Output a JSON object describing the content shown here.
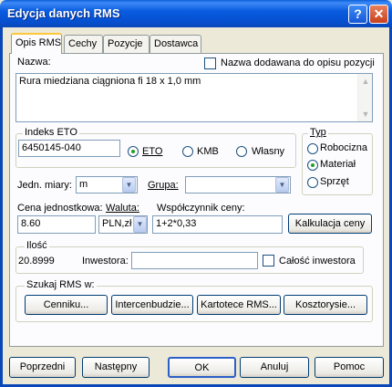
{
  "window": {
    "title": "Edycja danych RMS",
    "help_glyph": "?",
    "close_glyph": "✕"
  },
  "tabs": [
    "Opis RMS",
    "Cechy",
    "Pozycje",
    "Dostawca"
  ],
  "nazwa": {
    "label": "Nazwa:",
    "checkbox_label": "Nazwa dodawana do opisu pozycji",
    "value": "Rura miedziana ciągniona fi 18 x 1,0 mm"
  },
  "indeks": {
    "legend": "Indeks ETO",
    "value": "6450145-040",
    "options": [
      "ETO",
      "KMB",
      "Własny"
    ],
    "selected": "ETO"
  },
  "typ": {
    "legend": "Typ",
    "options": [
      "Robocizna",
      "Materiał",
      "Sprzęt"
    ],
    "selected": "Materiał"
  },
  "jednostka": {
    "label": "Jedn. miary:",
    "value": "m"
  },
  "grupa": {
    "label": "Grupa:",
    "value": ""
  },
  "cena": {
    "label": "Cena jednostkowa:",
    "value": "8.60",
    "waluta_label": "Waluta:",
    "waluta_value": "PLN,zł",
    "wsp_label": "Współczynnik ceny:",
    "wsp_value": "1+2*0,33",
    "kalkulacja_button": "Kalkulacja ceny"
  },
  "ilosc": {
    "legend": "Ilość",
    "value": "20.8999",
    "inwestora_label": "Inwestora:",
    "inwestora_value": "",
    "calosc_label": "Całość inwestora"
  },
  "szukaj": {
    "legend": "Szukaj RMS w:",
    "buttons": [
      "Cenniku...",
      "Intercenbudzie...",
      "Kartotece RMS...",
      "Kosztorysie..."
    ]
  },
  "footer": {
    "buttons": [
      "Poprzedni",
      "Następny",
      "OK",
      "Anuluj",
      "Pomoc"
    ]
  },
  "arrows": {
    "down": "▼",
    "up": "▲"
  }
}
